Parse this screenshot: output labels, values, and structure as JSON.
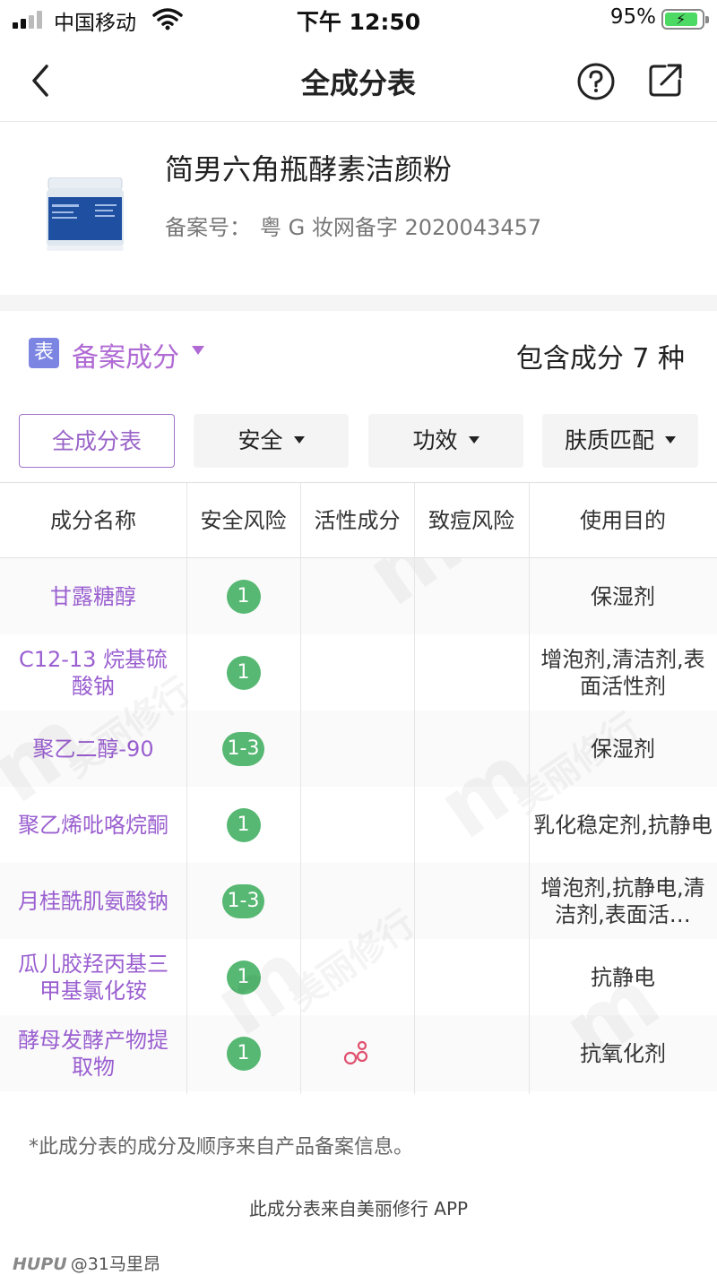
{
  "status_bar": {
    "carrier": "中国移动",
    "time": "下午 12:50",
    "battery_percent": "95%",
    "battery_level": 0.95,
    "battery_color": "#4cd964"
  },
  "nav": {
    "title": "全成分表",
    "back_icon": "chevron-left-icon",
    "help_icon": "question-circle-icon",
    "share_icon": "share-external-icon"
  },
  "product": {
    "name": "简男六角瓶酵素洁颜粉",
    "reg_label": "备案号：",
    "reg_value": "粤 G 妆网备字 2020043457"
  },
  "section": {
    "icon_text": "表",
    "title": "备案成分",
    "count_text": "包含成分 7 种",
    "accent_color": "#b06ad4"
  },
  "filters": [
    {
      "label": "全成分表",
      "active": true
    },
    {
      "label": "安全",
      "active": false
    },
    {
      "label": "功效",
      "active": false
    },
    {
      "label": "肤质匹配",
      "active": false
    }
  ],
  "table": {
    "headers": [
      "成分名称",
      "安全风险",
      "活性成分",
      "致痘风险",
      "使用目的"
    ],
    "rows": [
      {
        "name": "甘露糖醇",
        "safety": "1",
        "active": false,
        "acne": "",
        "purpose": "保湿剂"
      },
      {
        "name": "C12-13 烷基硫酸钠",
        "safety": "1",
        "active": false,
        "acne": "",
        "purpose": "增泡剂,清洁剂,表面活性剂"
      },
      {
        "name": "聚乙二醇-90",
        "safety": "1-3",
        "active": false,
        "acne": "",
        "purpose": "保湿剂"
      },
      {
        "name": "聚乙烯吡咯烷酮",
        "safety": "1",
        "active": false,
        "acne": "",
        "purpose": "乳化稳定剂,抗静电"
      },
      {
        "name": "月桂酰肌氨酸钠",
        "safety": "1-3",
        "active": false,
        "acne": "",
        "purpose": "增泡剂,抗静电,清洁剂,表面活…"
      },
      {
        "name": "瓜儿胶羟丙基三甲基氯化铵",
        "safety": "1",
        "active": false,
        "acne": "",
        "purpose": "抗静电"
      },
      {
        "name": "酵母发酵产物提取物",
        "safety": "1",
        "active": true,
        "acne": "",
        "purpose": "抗氧化剂"
      }
    ],
    "badge_color": "#56b872",
    "active_icon": "molecule-icon"
  },
  "footer": {
    "note": "*此成分表的成分及顺序来自产品备案信息。",
    "source": "此成分表来自美丽修行 APP",
    "credit_brand": "HUPU",
    "credit_user": "@31马里昂"
  },
  "watermark_text": "美丽修行"
}
